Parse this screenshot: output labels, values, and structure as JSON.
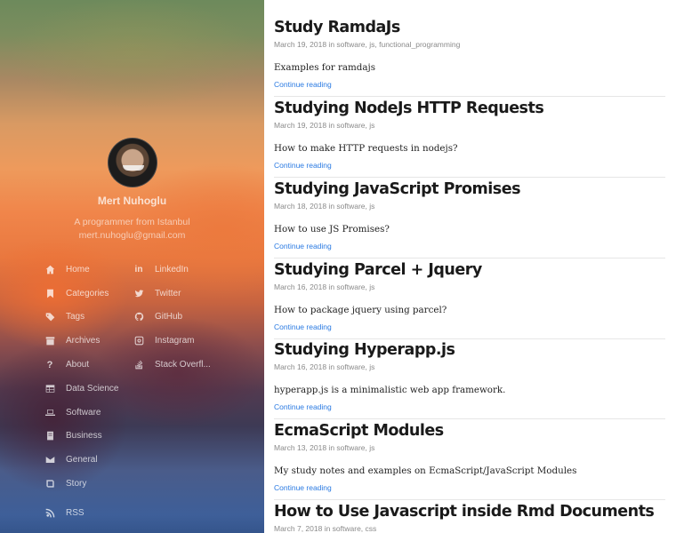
{
  "author": {
    "name": "Mert Nuhoglu",
    "bio": "A programmer from Istanbul",
    "email": "mert.nuhoglu@gmail.com"
  },
  "nav_left": [
    {
      "label": "Home",
      "icon": "home-icon"
    },
    {
      "label": "Categories",
      "icon": "bookmark-icon"
    },
    {
      "label": "Tags",
      "icon": "tags-icon"
    },
    {
      "label": "Archives",
      "icon": "archive-icon"
    },
    {
      "label": "About",
      "icon": "question-icon"
    },
    {
      "label": "Data Science",
      "icon": "table-icon"
    },
    {
      "label": "Software",
      "icon": "laptop-icon"
    },
    {
      "label": "Business",
      "icon": "book-icon"
    },
    {
      "label": "General",
      "icon": "envelope-icon"
    },
    {
      "label": "Story",
      "icon": "book-open-icon"
    }
  ],
  "nav_right": [
    {
      "label": "LinkedIn",
      "icon": "linkedin-icon"
    },
    {
      "label": "Twitter",
      "icon": "twitter-icon"
    },
    {
      "label": "GitHub",
      "icon": "github-icon"
    },
    {
      "label": "Instagram",
      "icon": "instagram-icon"
    },
    {
      "label": "Stack Overfl...",
      "icon": "stackoverflow-icon"
    }
  ],
  "rss": {
    "label": "RSS",
    "icon": "rss-icon"
  },
  "posts": [
    {
      "title": "Study RamdaJs",
      "meta": "March 19, 2018 in software, js, functional_programming",
      "excerpt": "Examples for ramdajs",
      "more": "Continue reading"
    },
    {
      "title": "Studying NodeJs HTTP Requests",
      "meta": "March 19, 2018 in software, js",
      "excerpt": "How to make HTTP requests in nodejs?",
      "more": "Continue reading"
    },
    {
      "title": "Studying JavaScript Promises",
      "meta": "March 18, 2018 in software, js",
      "excerpt": "How to use JS Promises?",
      "more": "Continue reading"
    },
    {
      "title": "Studying Parcel + Jquery",
      "meta": "March 16, 2018 in software, js",
      "excerpt": "How to package jquery using parcel?",
      "more": "Continue reading"
    },
    {
      "title": "Studying Hyperapp.js",
      "meta": "March 16, 2018 in software, js",
      "excerpt": "hyperapp.js is a minimalistic web app framework.",
      "more": "Continue reading"
    },
    {
      "title": "EcmaScript Modules",
      "meta": "March 13, 2018 in software, js",
      "excerpt": "My study notes and examples on EcmaScript/JavaScript Modules",
      "more": "Continue reading"
    },
    {
      "title": "How to Use Javascript inside Rmd Documents",
      "meta": "March 7, 2018 in software, css",
      "excerpt": "",
      "more": ""
    }
  ],
  "colors": {
    "link": "#2a7ae2",
    "meta": "#8a8a8a",
    "title": "#1a1a1a"
  }
}
